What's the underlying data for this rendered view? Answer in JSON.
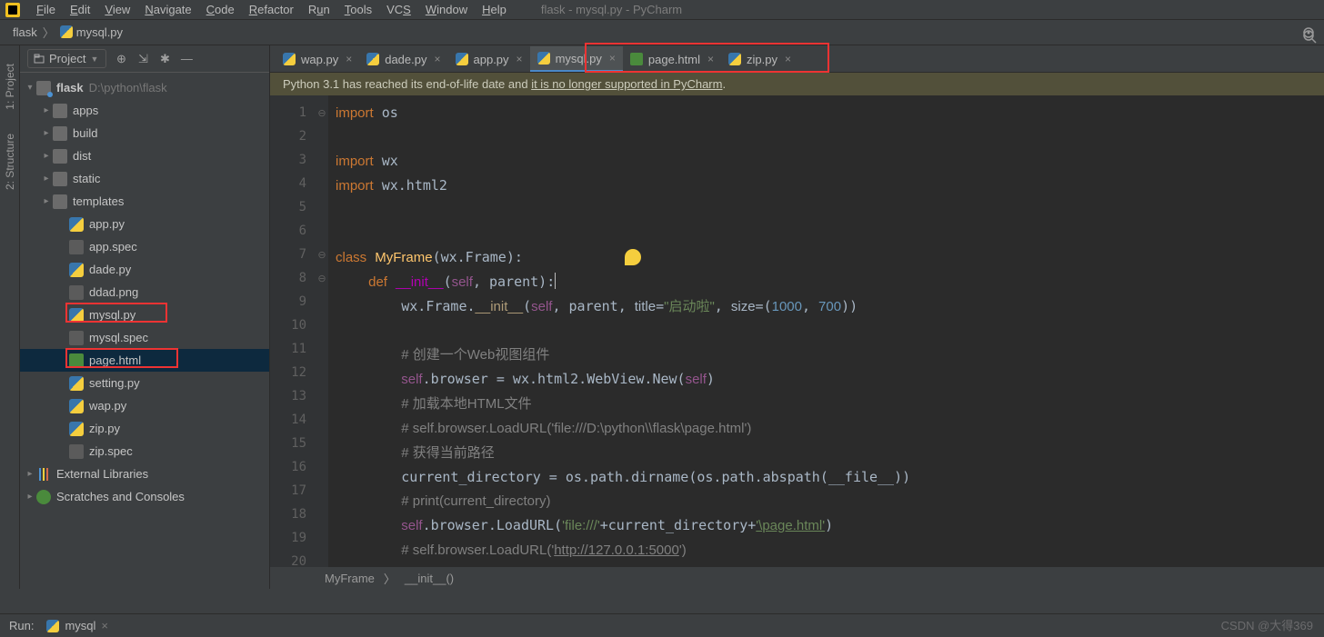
{
  "menu": {
    "items": [
      "File",
      "Edit",
      "View",
      "Navigate",
      "Code",
      "Refactor",
      "Run",
      "Tools",
      "VCS",
      "Window",
      "Help"
    ],
    "title": "flask - mysql.py - PyCharm"
  },
  "crumbs": {
    "project": "flask",
    "file": "mysql.py"
  },
  "leftrail": {
    "items": [
      "1: Project",
      "2: Structure"
    ]
  },
  "project_panel": {
    "selector": "Project",
    "root": {
      "label": "flask",
      "hint": "D:\\python\\flask"
    },
    "folders": [
      "apps",
      "build",
      "dist",
      "static",
      "templates"
    ],
    "files": [
      {
        "name": "app.py",
        "type": "py"
      },
      {
        "name": "app.spec",
        "type": "spec"
      },
      {
        "name": "dade.py",
        "type": "py"
      },
      {
        "name": "ddad.png",
        "type": "img"
      },
      {
        "name": "mysql.py",
        "type": "py"
      },
      {
        "name": "mysql.spec",
        "type": "spec"
      },
      {
        "name": "page.html",
        "type": "html"
      },
      {
        "name": "setting.py",
        "type": "py"
      },
      {
        "name": "wap.py",
        "type": "py"
      },
      {
        "name": "zip.py",
        "type": "py"
      },
      {
        "name": "zip.spec",
        "type": "spec"
      }
    ],
    "external": "External Libraries",
    "scratches": "Scratches and Consoles"
  },
  "tabs": [
    {
      "label": "wap.py",
      "type": "py",
      "active": false
    },
    {
      "label": "dade.py",
      "type": "py",
      "active": false
    },
    {
      "label": "app.py",
      "type": "py",
      "active": false
    },
    {
      "label": "mysql.py",
      "type": "py",
      "active": true
    },
    {
      "label": "page.html",
      "type": "html",
      "active": false
    },
    {
      "label": "zip.py",
      "type": "py",
      "active": false
    }
  ],
  "banner": "Python 3.1 has reached its end-of-life date and it is no longer supported in PyCharm.",
  "code": {
    "lines": [
      1,
      2,
      3,
      4,
      5,
      6,
      7,
      8,
      9,
      10,
      11,
      12,
      13,
      14,
      15,
      16,
      17,
      18,
      19,
      20
    ],
    "text": {
      "l1": "import os",
      "l3": "import wx",
      "l4": "import wx.html2",
      "l7": "class MyFrame(wx.Frame):",
      "l8": "    def __init__(self, parent):",
      "l9": "        wx.Frame.__init__(self, parent, title=\"启动啦\", size=(1000, 700))",
      "l11": "        # 创建一个Web视图组件",
      "l12": "        self.browser = wx.html2.WebView.New(self)",
      "l13": "        # 加载本地HTML文件",
      "l14": "        # self.browser.LoadURL('file:///D:\\python\\\\flask\\page.html')",
      "l15": "        # 获得当前路径",
      "l16": "        current_directory = os.path.dirname(os.path.abspath(__file__))",
      "l17": "        # print(current_directory)",
      "l18a": "        self.browser.LoadURL(",
      "l18b": "'file:///'",
      "l18c": "+current_directory+",
      "l18d": "'\\page.html'",
      "l18e": ")",
      "l19": "        # self.browser.LoadURL('http://127.0.0.1:5000')"
    }
  },
  "nav2": {
    "a": "MyFrame",
    "b": "__init__()"
  },
  "run": {
    "label": "Run:",
    "tab": "mysql"
  },
  "watermark": "CSDN @大得369"
}
